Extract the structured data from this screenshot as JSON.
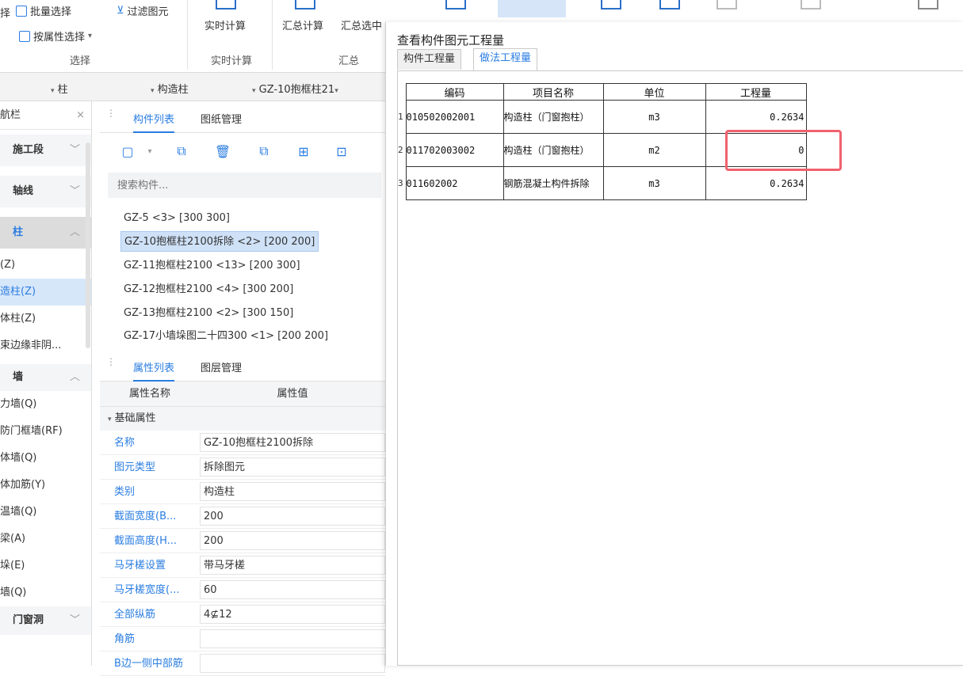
{
  "ribbon": {
    "batch_select": "批量选择",
    "filter": "过滤图元",
    "by_attr": "按属性选择",
    "group_select": "选择",
    "realtime_calc": "实时计算",
    "group_realtime": "实时计算",
    "sum_calc": "汇总计算",
    "sum_selected": "汇总选中",
    "group_sum": "汇总",
    "left_partial": "择"
  },
  "combo": {
    "item1": "柱",
    "item2": "构造柱",
    "item3": "GZ-10抱框柱21"
  },
  "nav": {
    "header": "航栏",
    "close": "×",
    "categories": [
      {
        "label": "施工段",
        "chev": "﹀"
      },
      {
        "label": "轴线",
        "chev": "﹀"
      },
      {
        "label": "柱",
        "chev": "︿"
      }
    ],
    "col_items": [
      "(Z)",
      "造柱(Z)",
      "体柱(Z)",
      "束边缘非阴..."
    ],
    "wall_cat": {
      "label": "墙",
      "chev": "︿"
    },
    "wall_items": [
      "力墙(Q)",
      "防门框墙(RF)",
      "体墙(Q)",
      "体加筋(Y)",
      "温墙(Q)",
      "梁(A)",
      "垛(E)",
      "墙(Q)"
    ],
    "door_cat": {
      "label": "门窗洞",
      "chev": "﹀"
    }
  },
  "comp_panel": {
    "tab1": "构件列表",
    "tab2": "图纸管理",
    "search_placeholder": "搜索构件...",
    "items": [
      "GZ-5 <3> [300 300]",
      "GZ-10抱框柱2100拆除 <2> [200 200]",
      "GZ-11抱框柱2100 <13> [200 300]",
      "GZ-12抱框柱2100 <4> [300 200]",
      "GZ-13抱框柱2100 <2> [300 150]",
      "GZ-17小墙垛图二十四300 <1> [200 200]"
    ]
  },
  "prop_panel": {
    "tab1": "属性列表",
    "tab2": "图层管理",
    "col_name": "属性名称",
    "col_value": "属性值",
    "group": "基础属性",
    "rows": [
      {
        "name": "名称",
        "value": "GZ-10抱框柱2100拆除"
      },
      {
        "name": "图元类型",
        "value": "拆除图元"
      },
      {
        "name": "类别",
        "value": "构造柱"
      },
      {
        "name": "截面宽度(B...",
        "value": "200"
      },
      {
        "name": "截面高度(H...",
        "value": "200"
      },
      {
        "name": "马牙槎设置",
        "value": "带马牙槎"
      },
      {
        "name": "马牙槎宽度(...",
        "value": "60"
      },
      {
        "name": "全部纵筋",
        "value": "4⊈12"
      },
      {
        "name": "角筋",
        "value": ""
      },
      {
        "name": "B边一侧中部筋",
        "value": ""
      }
    ]
  },
  "dialog": {
    "title": "查看构件图元工程量",
    "tab1": "构件工程量",
    "tab2": "做法工程量",
    "headers": [
      "编码",
      "项目名称",
      "单位",
      "工程量"
    ],
    "rows": [
      {
        "idx": "1",
        "code": "010502002001",
        "name": "构造柱（门窗抱柱）",
        "unit": "m3",
        "qty": "0.2634"
      },
      {
        "idx": "2",
        "code": "011702003002",
        "name": "构造柱（门窗抱柱）",
        "unit": "m2",
        "qty": "0"
      },
      {
        "idx": "3",
        "code": "011602002",
        "name": "钢筋混凝土构件拆除",
        "unit": "m3",
        "qty": "0.2634"
      }
    ]
  },
  "colors": {
    "accent": "#2a7de1",
    "highlight": "#f0616e"
  }
}
